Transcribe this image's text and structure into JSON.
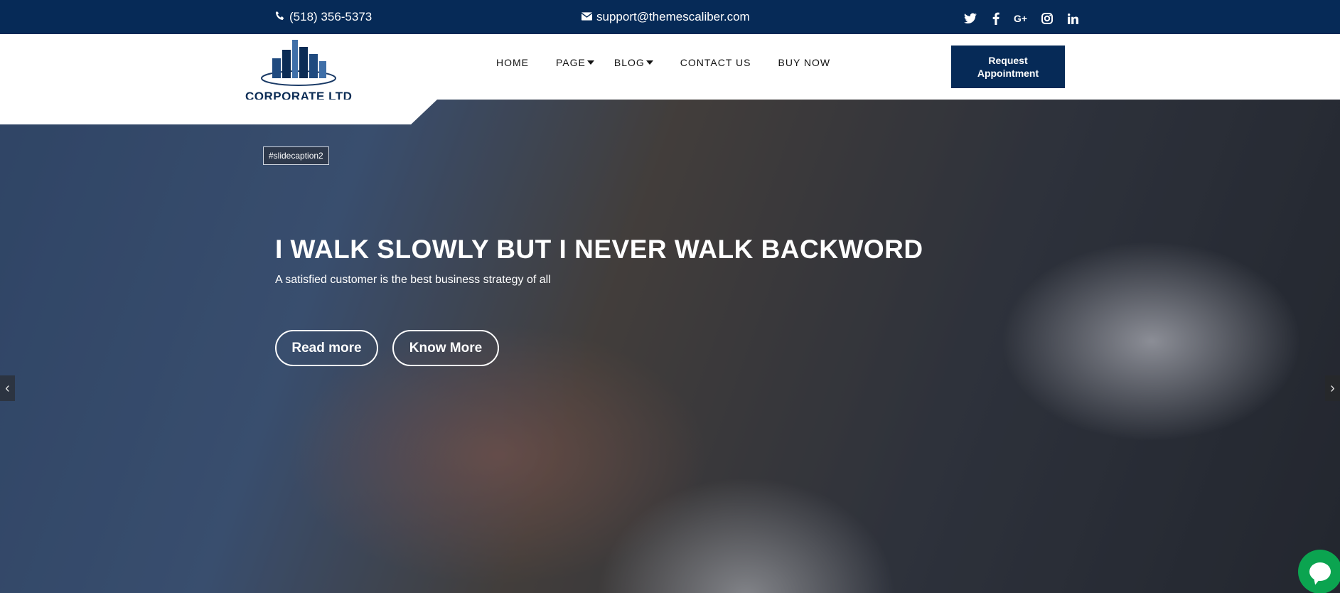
{
  "topbar": {
    "phone": "(518) 356-5373",
    "email": "support@themescaliber.com",
    "social": [
      "twitter-icon",
      "facebook-icon",
      "google-plus-icon",
      "instagram-icon",
      "linkedin-icon"
    ]
  },
  "header": {
    "logo_text": "CORPORATE LTD",
    "nav": {
      "home": "HOME",
      "page": "PAGE",
      "blog": "BLOG",
      "contact": "CONTACT US",
      "buy": "BUY NOW"
    },
    "cta": "Request Appointment"
  },
  "hero": {
    "caption_tag": "#slidecaption2",
    "title": "I WALK SLOWLY BUT I NEVER WALK BACKWORD",
    "subtitle": "A satisfied customer is the best business strategy of all",
    "read_more": "Read more",
    "know_more": "Know More",
    "prev_arrow": "‹",
    "next_arrow": "›"
  },
  "colors": {
    "navy": "#062a57",
    "chat_green": "#0ba450"
  }
}
